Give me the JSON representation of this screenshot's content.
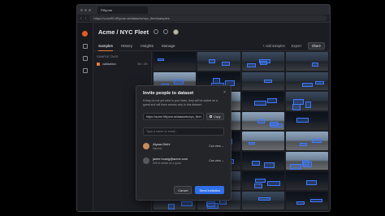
{
  "browser": {
    "tab_title": "Fiftyone",
    "url": "https://voxel51.fiftyone.ai/datasets/nyc_fleet/samples"
  },
  "header": {
    "title": "Acme / NYC Fleet"
  },
  "tabs": [
    {
      "label": "Samples"
    },
    {
      "label": "History"
    },
    {
      "label": "Insights"
    },
    {
      "label": "Manage"
    }
  ],
  "toolbar": {
    "add_samples": "+ Add samples",
    "export": "Export",
    "share": "Share"
  },
  "sidepanel": {
    "header": "SAMPLE TAGS",
    "row_label": "validation",
    "row_count": "50 / 2K"
  },
  "modal": {
    "title": "Invite people to dataset",
    "description": "If they do not yet exist in your team, they will be added as a guest and will have access only to this dataset.",
    "link": "https://acme.fiftyone.ai/datasets/nyc_fleet",
    "copy_label": "Copy",
    "email_placeholder": "Type a name or email...",
    "members": [
      {
        "name": "Alyssa Diehl",
        "role": "Member",
        "permission": "Can view ⌄"
      },
      {
        "name": "jamie.hoang@acme.com",
        "role": "Will be added as a guest",
        "permission": "Can view ⌄"
      }
    ],
    "cancel_label": "Cancel",
    "send_label": "Send invitation",
    "close_icon": "close-icon"
  },
  "colors": {
    "accent": "#f07a3a",
    "primary_button": "#2f6fe8",
    "detection_box": "#3e7bff"
  }
}
